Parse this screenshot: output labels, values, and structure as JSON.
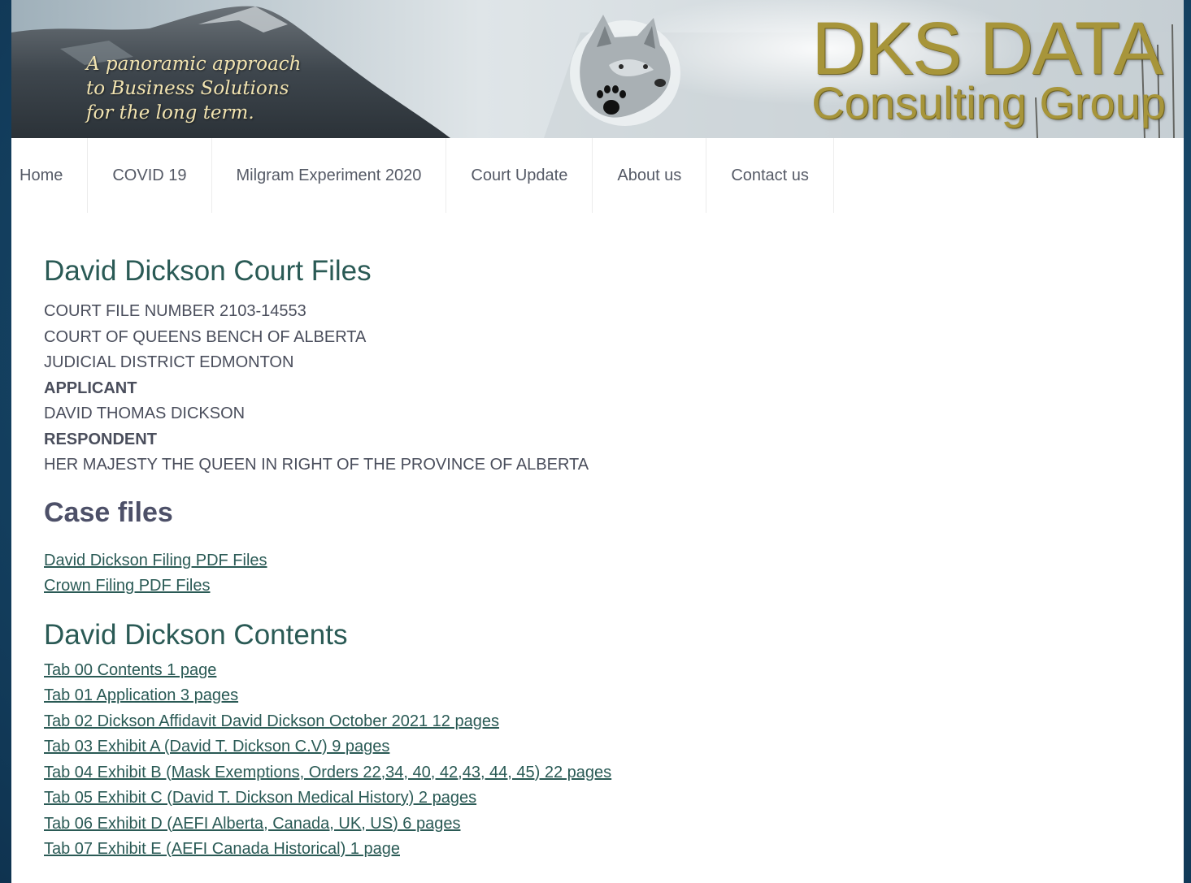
{
  "banner": {
    "tagline": [
      "A panoramic approach",
      "to Business Solutions",
      "for the long term."
    ],
    "brand_line1": "DKS DATA",
    "brand_line2": "Consulting Group"
  },
  "nav": [
    "Home",
    "COVID 19",
    "Milgram Experiment 2020",
    "Court Update",
    "About us",
    "Contact us"
  ],
  "main": {
    "title": "David Dickson Court Files",
    "info": [
      {
        "text": "COURT FILE NUMBER 2103-14553",
        "bold": false
      },
      {
        "text": "COURT OF QUEENS BENCH OF ALBERTA",
        "bold": false
      },
      {
        "text": "JUDICIAL DISTRICT EDMONTON",
        "bold": false
      },
      {
        "text": "APPLICANT",
        "bold": true
      },
      {
        "text": "DAVID THOMAS DICKSON",
        "bold": false
      },
      {
        "text": "RESPONDENT",
        "bold": true
      },
      {
        "text": "HER MAJESTY THE QUEEN IN RIGHT OF THE PROVINCE OF ALBERTA",
        "bold": false
      }
    ],
    "case_files_heading": "Case files",
    "case_links": [
      "David Dickson Filing PDF Files",
      "Crown Filing PDF Files"
    ],
    "contents_heading": "David Dickson Contents",
    "tab_links": [
      "Tab 00 Contents 1 page",
      "Tab 01 Application 3 pages",
      "Tab 02 Dickson Affidavit David Dickson October 2021 12 pages",
      "Tab 03 Exhibit A (David T. Dickson C.V) 9 pages",
      "Tab 04 Exhibit B (Mask Exemptions, Orders 22,34, 40, 42,43, 44, 45) 22 pages",
      "Tab 05 Exhibit C (David T. Dickson Medical History) 2 pages",
      "Tab 06 Exhibit D (AEFI Alberta, Canada, UK, US) 6 pages",
      "Tab 07 Exhibit E (AEFI Canada Historical) 1 page"
    ]
  }
}
